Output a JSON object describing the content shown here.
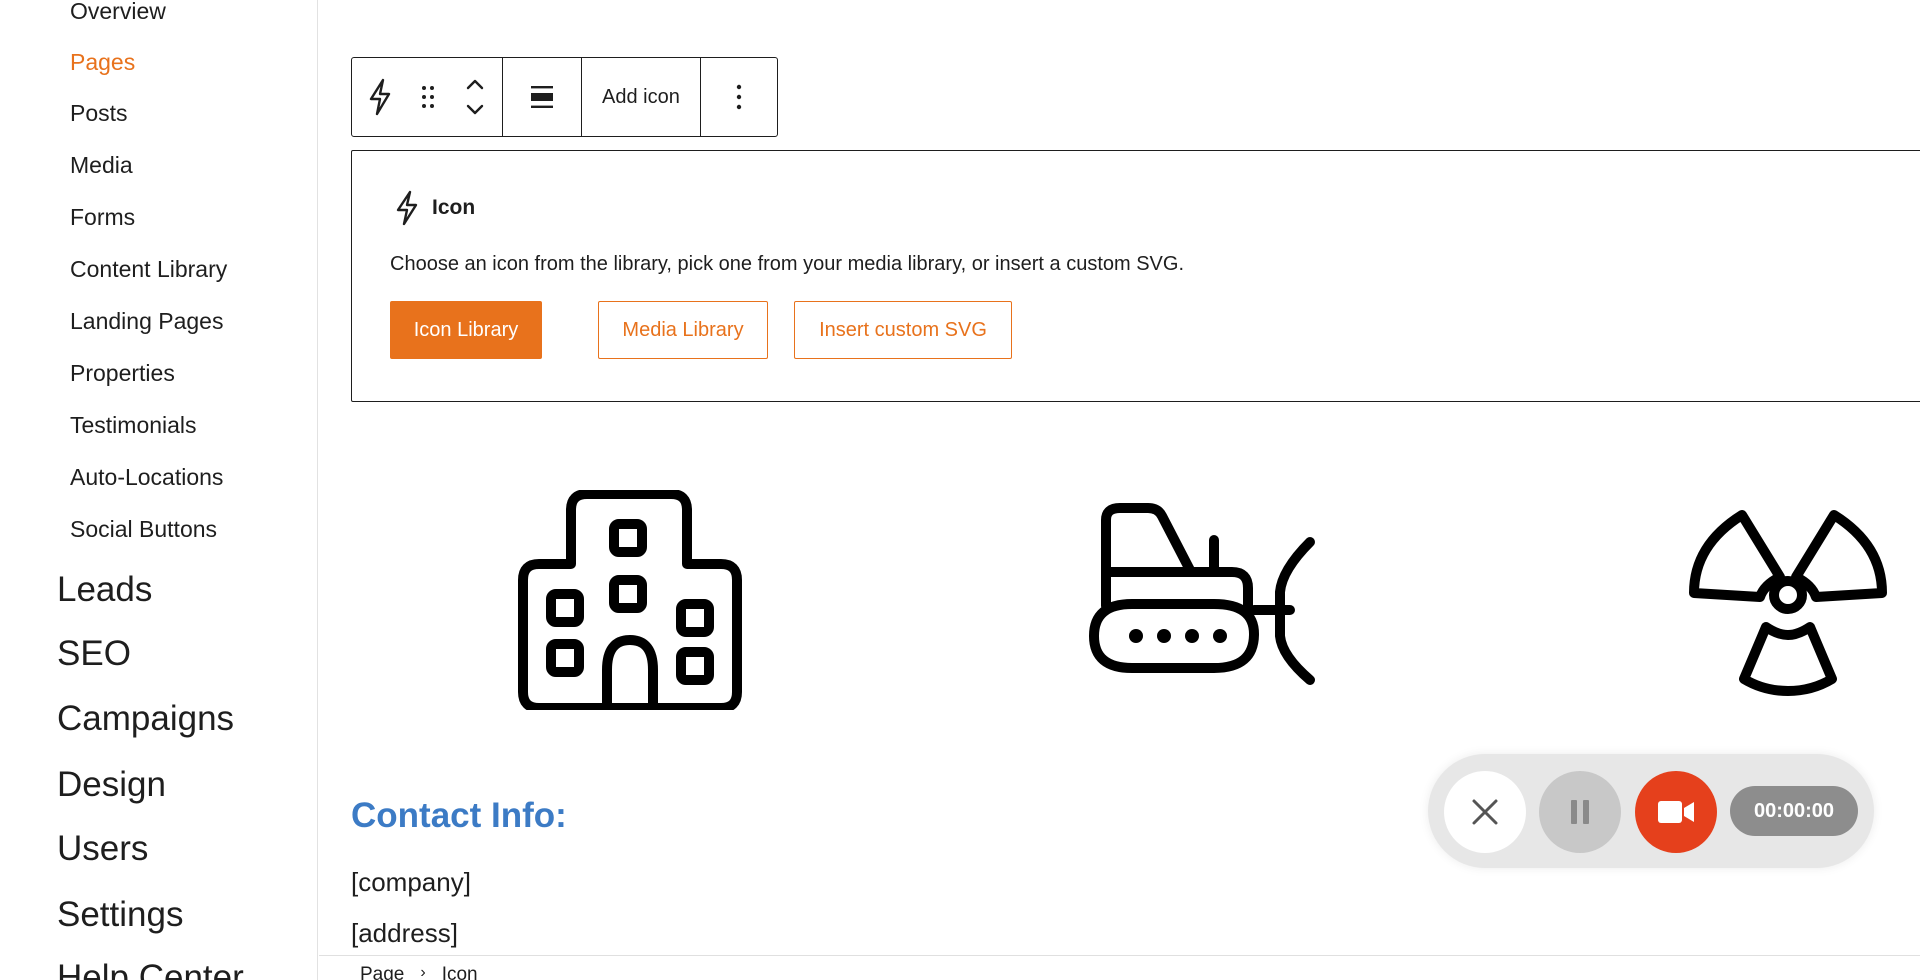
{
  "sidebar": {
    "sub_items": [
      {
        "label": "Overview",
        "active": false
      },
      {
        "label": "Pages",
        "active": true
      },
      {
        "label": "Posts",
        "active": false
      },
      {
        "label": "Media",
        "active": false
      },
      {
        "label": "Forms",
        "active": false
      },
      {
        "label": "Content Library",
        "active": false
      },
      {
        "label": "Landing Pages",
        "active": false
      },
      {
        "label": "Properties",
        "active": false
      },
      {
        "label": "Testimonials",
        "active": false
      },
      {
        "label": "Auto-Locations",
        "active": false
      },
      {
        "label": "Social Buttons",
        "active": false
      }
    ],
    "main_items": [
      {
        "label": "Leads"
      },
      {
        "label": "SEO"
      },
      {
        "label": "Campaigns"
      },
      {
        "label": "Design"
      },
      {
        "label": "Users"
      },
      {
        "label": "Settings"
      },
      {
        "label": "Help Center"
      }
    ]
  },
  "toolbar": {
    "block_icon": "lightning-icon",
    "drag_icon": "drag-handle-icon",
    "move_icon": "chevron-up-down-icon",
    "align_icon": "align-center-icon",
    "add_icon_label": "Add icon",
    "options_icon": "more-vertical-icon"
  },
  "icon_block": {
    "title": "Icon",
    "description": "Choose an icon from the library, pick one from your media library, or insert a custom SVG.",
    "buttons": {
      "icon_library": "Icon Library",
      "media_library": "Media Library",
      "insert_svg": "Insert custom SVG"
    }
  },
  "icons_row": [
    "building-icon",
    "bulldozer-icon",
    "radiation-icon"
  ],
  "contact": {
    "title": "Contact Info:",
    "company": "[company]",
    "address": "[address]"
  },
  "breadcrumb": {
    "items": [
      "Page",
      "Icon"
    ]
  },
  "recorder": {
    "timer": "00:00:00"
  },
  "colors": {
    "accent": "#e8721c",
    "contact_title": "#3c7bc5",
    "record": "#e5401c"
  }
}
